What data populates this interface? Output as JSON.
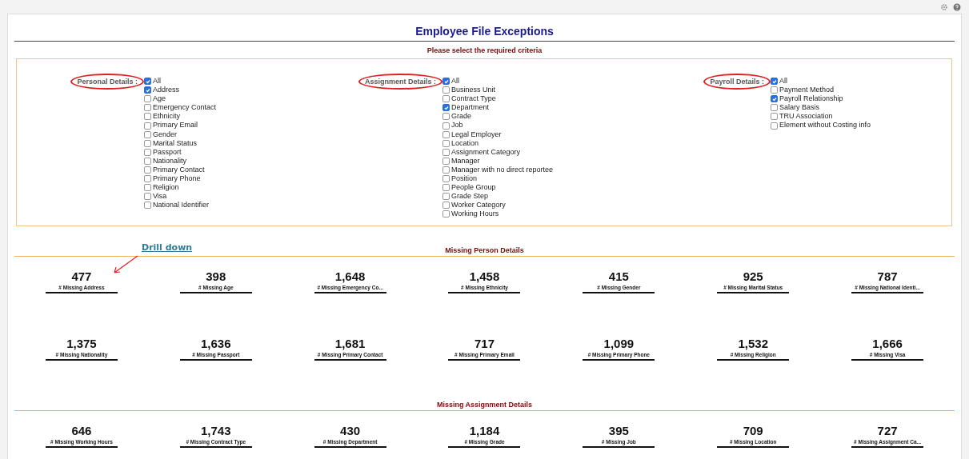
{
  "title": "Employee File Exceptions",
  "criteria": {
    "heading": "Please select the required criteria",
    "groups": [
      {
        "label": "Personal Details :",
        "circled": true,
        "options": [
          {
            "label": "All",
            "checked": true
          },
          {
            "label": "Address",
            "checked": true
          },
          {
            "label": "Age",
            "checked": false
          },
          {
            "label": "Emergency Contact",
            "checked": false
          },
          {
            "label": "Ethnicity",
            "checked": false
          },
          {
            "label": "Primary Email",
            "checked": false
          },
          {
            "label": "Gender",
            "checked": false
          },
          {
            "label": "Marital Status",
            "checked": false
          },
          {
            "label": "Passport",
            "checked": false
          },
          {
            "label": "Nationality",
            "checked": false
          },
          {
            "label": "Primary Contact",
            "checked": false
          },
          {
            "label": "Primary Phone",
            "checked": false
          },
          {
            "label": "Religion",
            "checked": false
          },
          {
            "label": "Visa",
            "checked": false
          },
          {
            "label": "National Identifier",
            "checked": false
          }
        ]
      },
      {
        "label": "Assignment Details :",
        "circled": true,
        "options": [
          {
            "label": "All",
            "checked": true
          },
          {
            "label": "Business Unit",
            "checked": false
          },
          {
            "label": "Contract Type",
            "checked": false
          },
          {
            "label": "Department",
            "checked": true
          },
          {
            "label": "Grade",
            "checked": false
          },
          {
            "label": "Job",
            "checked": false
          },
          {
            "label": "Legal Employer",
            "checked": false
          },
          {
            "label": "Location",
            "checked": false
          },
          {
            "label": "Assignment Category",
            "checked": false
          },
          {
            "label": "Manager",
            "checked": false
          },
          {
            "label": "Manager with no direct reportee",
            "checked": false
          },
          {
            "label": "Position",
            "checked": false
          },
          {
            "label": "People Group",
            "checked": false
          },
          {
            "label": "Grade Step",
            "checked": false
          },
          {
            "label": "Worker Category",
            "checked": false
          },
          {
            "label": "Working Hours",
            "checked": false
          }
        ]
      },
      {
        "label": "Payroll Details :",
        "circled": true,
        "options": [
          {
            "label": "All",
            "checked": true
          },
          {
            "label": "Payment Method",
            "checked": false
          },
          {
            "label": "Payroll Relationship",
            "checked": true
          },
          {
            "label": "Salary Basis",
            "checked": false
          },
          {
            "label": "TRU Association",
            "checked": false
          },
          {
            "label": "Element without Costing info",
            "checked": false
          }
        ]
      }
    ]
  },
  "annotation": {
    "text": "Drill down"
  },
  "sections": [
    {
      "heading": "Missing Person Details",
      "metrics": [
        {
          "value": "477",
          "label": "# Missing Address"
        },
        {
          "value": "398",
          "label": "# Missing Age"
        },
        {
          "value": "1,648",
          "label": "# Missing Emergency Co..."
        },
        {
          "value": "1,458",
          "label": "# Missing Ethnicity"
        },
        {
          "value": "415",
          "label": "# Missing Gender"
        },
        {
          "value": "925",
          "label": "# Missing Marital Status"
        },
        {
          "value": "787",
          "label": "# Missing National Identi..."
        },
        {
          "value": "1,375",
          "label": "# Missing Nationality"
        },
        {
          "value": "1,636",
          "label": "# Missing Passport"
        },
        {
          "value": "1,681",
          "label": "# Missing Primary Contact"
        },
        {
          "value": "717",
          "label": "# Missing Primary Email"
        },
        {
          "value": "1,099",
          "label": "# Missing Primary Phone"
        },
        {
          "value": "1,532",
          "label": "# Missing Religion"
        },
        {
          "value": "1,666",
          "label": "# Missing Visa"
        }
      ]
    },
    {
      "heading": "Missing Assignment Details",
      "metrics": [
        {
          "value": "646",
          "label": "# Missing Working Hours"
        },
        {
          "value": "1,743",
          "label": "# Missing Contract Type"
        },
        {
          "value": "430",
          "label": "# Missing Department"
        },
        {
          "value": "1,184",
          "label": "# Missing Grade"
        },
        {
          "value": "395",
          "label": "# Missing Job"
        },
        {
          "value": "709",
          "label": "# Missing Location"
        },
        {
          "value": "727",
          "label": "# Missing Assignment Ca..."
        }
      ]
    }
  ]
}
